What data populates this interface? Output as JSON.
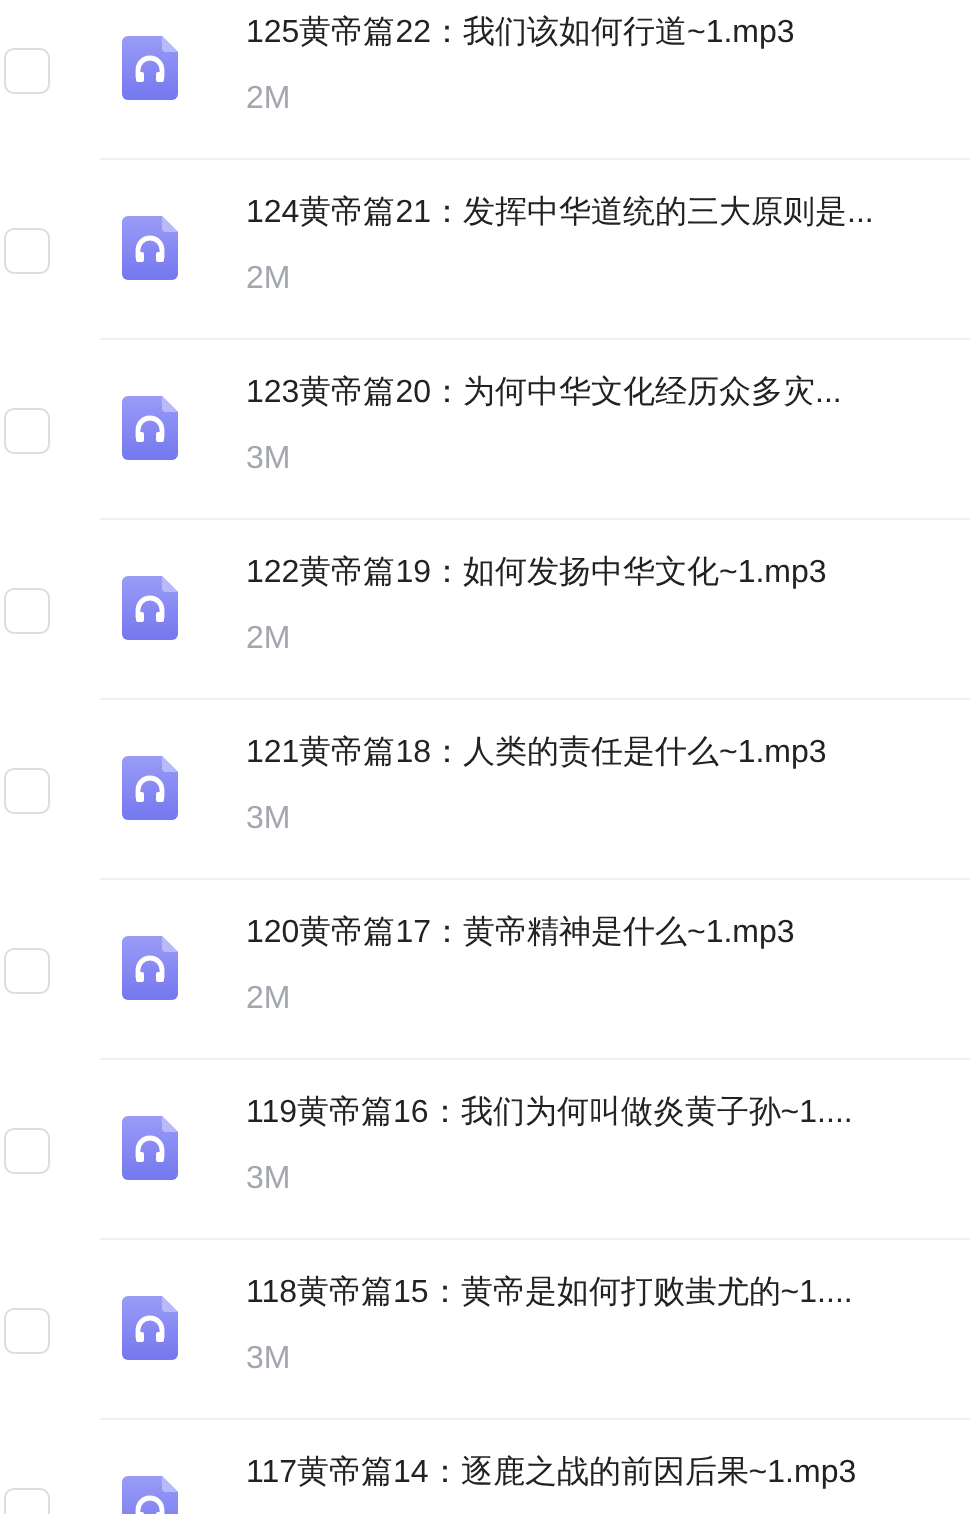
{
  "files": [
    {
      "name": "125黄帝篇22：我们该如何行道~1.mp3",
      "size": "2M",
      "checked": false
    },
    {
      "name": "124黄帝篇21：发挥中华道统的三大原则是...",
      "size": "2M",
      "checked": false
    },
    {
      "name": "123黄帝篇20：为何中华文化经历众多灾...",
      "size": "3M",
      "checked": false
    },
    {
      "name": "122黄帝篇19：如何发扬中华文化~1.mp3",
      "size": "2M",
      "checked": false
    },
    {
      "name": "121黄帝篇18：人类的责任是什么~1.mp3",
      "size": "3M",
      "checked": false
    },
    {
      "name": "120黄帝篇17：黄帝精神是什么~1.mp3",
      "size": "2M",
      "checked": false
    },
    {
      "name": "119黄帝篇16：我们为何叫做炎黄子孙~1....",
      "size": "3M",
      "checked": false
    },
    {
      "name": "118黄帝篇15：黄帝是如何打败蚩尤的~1....",
      "size": "3M",
      "checked": false
    },
    {
      "name": "117黄帝篇14：逐鹿之战的前因后果~1.mp3",
      "checked": false
    }
  ]
}
